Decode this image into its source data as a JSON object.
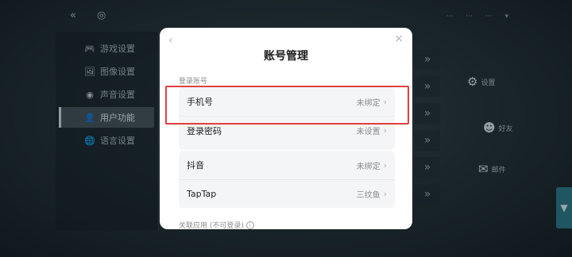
{
  "background": {
    "top_icons": [
      "«",
      "◎"
    ],
    "status_texts": [
      "···",
      "···",
      "···",
      "▾"
    ],
    "side_menu": [
      {
        "icon": "🎮",
        "icon_name": "gamepad-icon",
        "label": "游戏设置"
      },
      {
        "icon": "🖼",
        "icon_name": "image-icon",
        "label": "图像设置"
      },
      {
        "icon": "◉",
        "icon_name": "sound-icon",
        "label": "声音设置"
      },
      {
        "icon": "👤",
        "icon_name": "user-icon",
        "label": "用户功能"
      },
      {
        "icon": "🌐",
        "icon_name": "globe-icon",
        "label": "语言设置"
      }
    ],
    "chevron_glyph": "»",
    "right_icons": [
      {
        "glyph": "⚙",
        "label": "设置",
        "icon_name": "settings-icon"
      },
      {
        "glyph": "☻",
        "label": "好友",
        "icon_name": "friends-icon"
      },
      {
        "glyph": "✉",
        "label": "邮件",
        "icon_name": "mail-icon"
      }
    ],
    "edge_tab_glyph": "▼"
  },
  "modal": {
    "back_glyph": "‹",
    "close_glyph": "×",
    "title": "账号管理",
    "section_label": "登录账号",
    "group1": [
      {
        "label": "手机号",
        "value": "未绑定"
      },
      {
        "label": "登录密码",
        "value": "未设置"
      }
    ],
    "group2": [
      {
        "label": "抖音",
        "value": "未绑定"
      },
      {
        "label": "TapTap",
        "value": "三纹鱼"
      }
    ],
    "chevron": "›",
    "footer_label": "关联应用 (不可登录)",
    "info_glyph": "i"
  },
  "colors": {
    "highlight": "#e04040",
    "accent_tab": "#2c7b8a"
  }
}
